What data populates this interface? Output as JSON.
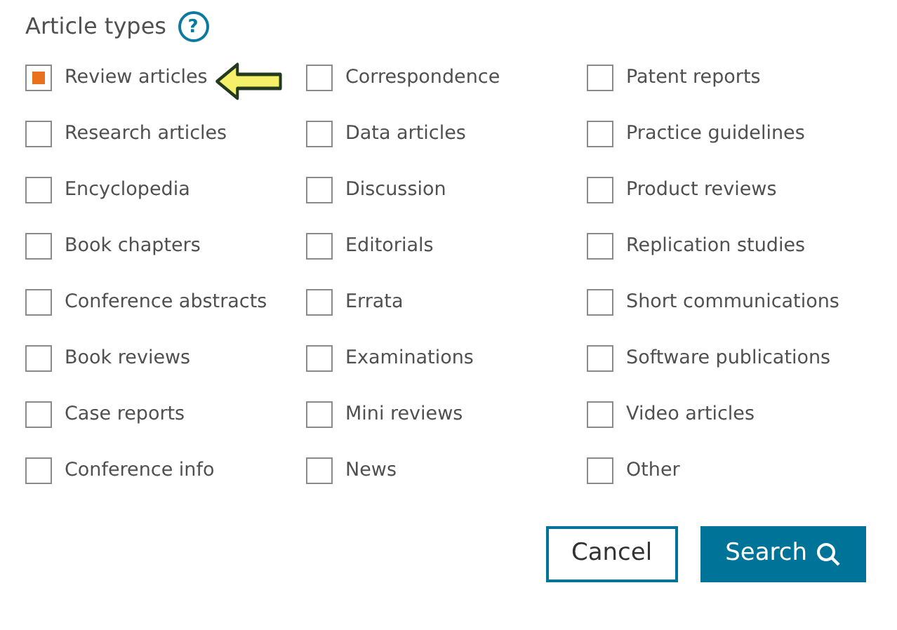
{
  "section": {
    "title": "Article types",
    "help": "?"
  },
  "article_types": [
    {
      "label": "Review articles",
      "checked": true
    },
    {
      "label": "Research articles",
      "checked": false
    },
    {
      "label": "Encyclopedia",
      "checked": false
    },
    {
      "label": "Book chapters",
      "checked": false
    },
    {
      "label": "Conference abstracts",
      "checked": false
    },
    {
      "label": "Book reviews",
      "checked": false
    },
    {
      "label": "Case reports",
      "checked": false
    },
    {
      "label": "Conference info",
      "checked": false
    },
    {
      "label": "Correspondence",
      "checked": false
    },
    {
      "label": "Data articles",
      "checked": false
    },
    {
      "label": "Discussion",
      "checked": false
    },
    {
      "label": "Editorials",
      "checked": false
    },
    {
      "label": "Errata",
      "checked": false
    },
    {
      "label": "Examinations",
      "checked": false
    },
    {
      "label": "Mini reviews",
      "checked": false
    },
    {
      "label": "News",
      "checked": false
    },
    {
      "label": "Patent reports",
      "checked": false
    },
    {
      "label": "Practice guidelines",
      "checked": false
    },
    {
      "label": "Product reviews",
      "checked": false
    },
    {
      "label": "Replication studies",
      "checked": false
    },
    {
      "label": "Short communications",
      "checked": false
    },
    {
      "label": "Software publications",
      "checked": false
    },
    {
      "label": "Video articles",
      "checked": false
    },
    {
      "label": "Other",
      "checked": false
    }
  ],
  "buttons": [
    {
      "label": "Cancel",
      "kind": "outline"
    },
    {
      "label": "Search",
      "kind": "primary"
    }
  ]
}
